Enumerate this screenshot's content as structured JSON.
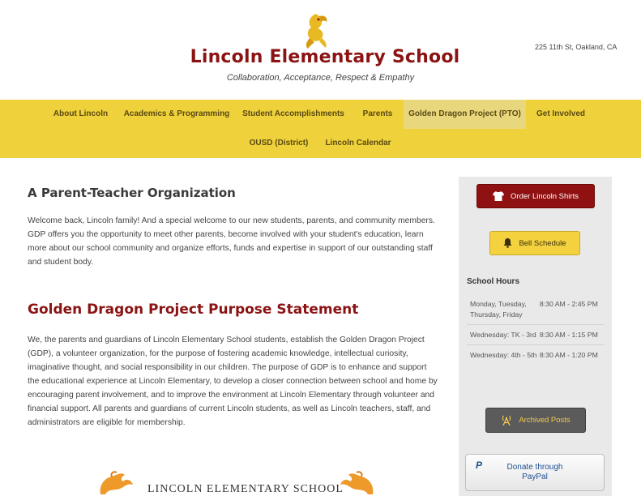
{
  "header": {
    "title": "Lincoln Elementary School",
    "tagline": "Collaboration, Acceptance, Respect & Empathy",
    "address": "225 11th St, Oakland, CA",
    "logo_icon": "dragon-logo-icon"
  },
  "nav": {
    "items": [
      {
        "label": "About Lincoln"
      },
      {
        "label": "Academics & Programming"
      },
      {
        "label": "Student Accomplishments"
      },
      {
        "label": "Parents"
      },
      {
        "label": "Golden Dragon Project (PTO)",
        "active": true
      },
      {
        "label": "Get Involved"
      },
      {
        "label": "OUSD (District)"
      },
      {
        "label": "Lincoln Calendar"
      }
    ]
  },
  "main": {
    "heading1": "A Parent-Teacher Organization",
    "para1": "Welcome back, Lincoln family! And a special welcome to our new students, parents, and community members. GDP offers you the opportunity to meet other parents, become involved with your student's education, learn more about our school community and organize efforts, funds and expertise in support of our outstanding staff and student body.",
    "heading2": "Golden Dragon Project Purpose Statement",
    "para2": "We, the parents and guardians of Lincoln Elementary School students, establish the Golden Dragon Project (GDP), a volunteer organization, for the purpose of fostering academic knowledge, intellectual curiosity, imaginative thought, and social responsibility in our children. The purpose of GDP is to enhance and support the educational experience at Lincoln Elementary, to develop a closer connection between school and home by encouraging parent involvement, and to improve the environment at Lincoln Elementary  through volunteer and financial support. All parents and guardians of current Lincoln students, as well as Lincoln teachers, staff, and administrators are eligible for membership.",
    "banner_text": "LINCOLN ELEMENTARY SCHOOL"
  },
  "sidebar": {
    "shirts_button": "Order Lincoln Shirts",
    "bell_button": "Bell Schedule",
    "hours_title": "School Hours",
    "hours": [
      {
        "day": "Monday, Tuesday, Thursday, Friday",
        "time": "8:30 AM - 2:45 PM"
      },
      {
        "day": "Wednesday: TK - 3rd",
        "time": "8:30 AM - 1:15 PM"
      },
      {
        "day": "Wednesday: 4th - 5th",
        "time": "8:30 AM - 1:20 PM"
      }
    ],
    "archive_button": "Archived Posts",
    "paypal_button_line1": "Donate through",
    "paypal_button_line2": "PayPal"
  },
  "colors": {
    "brand_red": "#8b1313",
    "nav_yellow": "#efd13b",
    "button_red": "#8f1111",
    "button_yellow": "#f4d23f",
    "paypal_blue": "#1d4f91"
  }
}
